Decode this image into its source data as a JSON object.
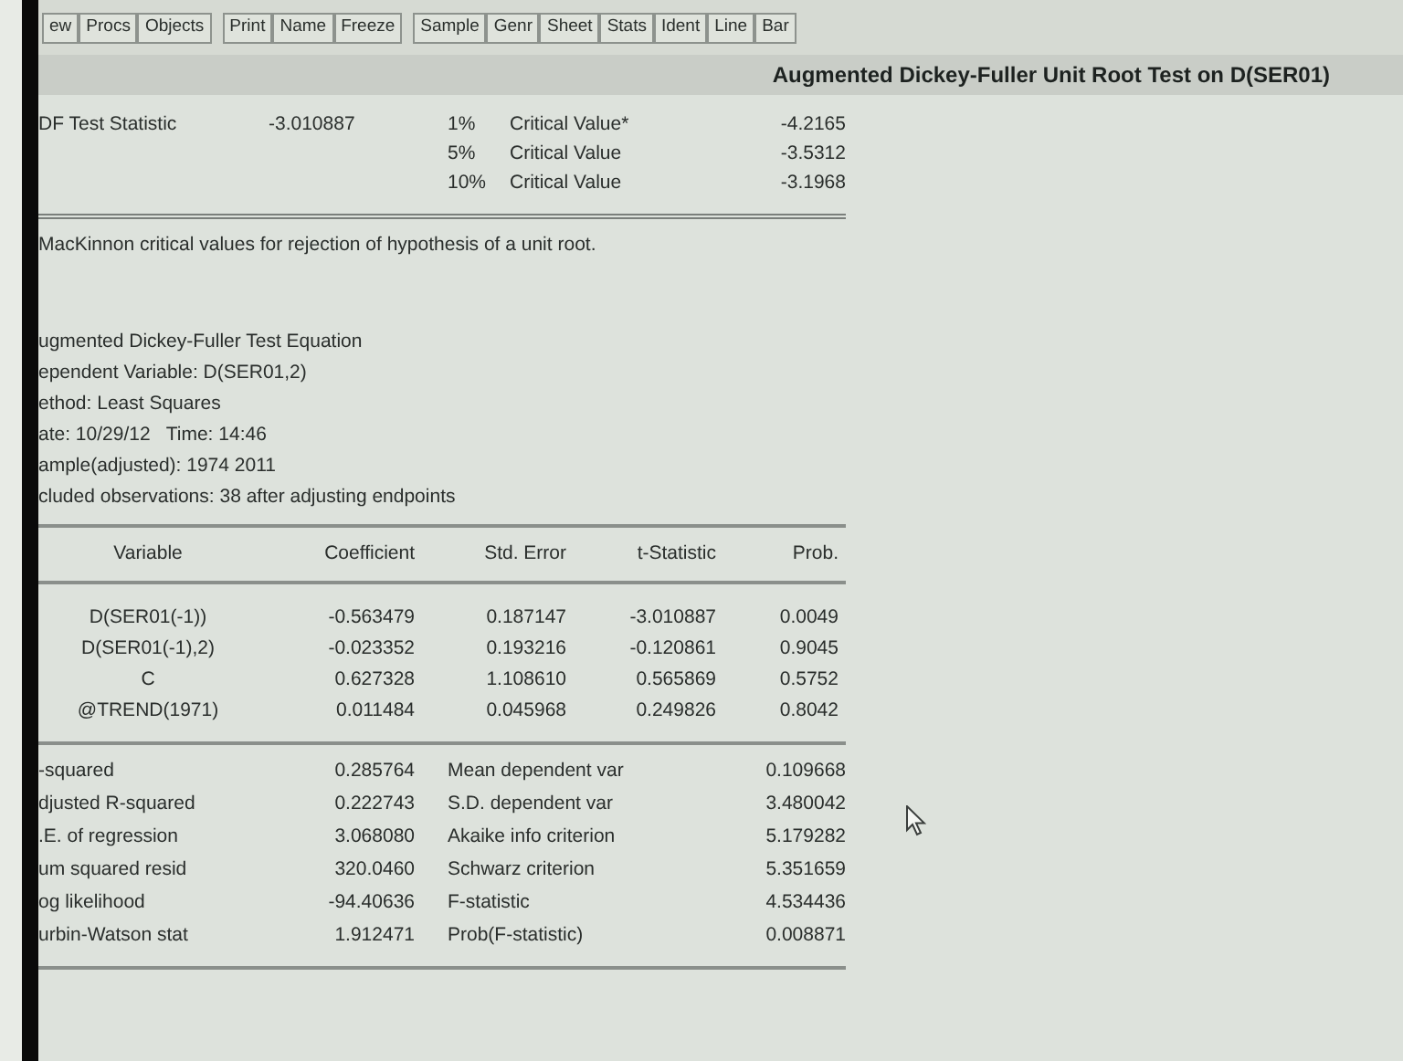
{
  "toolbar": {
    "groups": [
      [
        "ew",
        "Procs",
        "Objects"
      ],
      [
        "Print",
        "Name",
        "Freeze"
      ],
      [
        "Sample",
        "Genr",
        "Sheet",
        "Stats",
        "Ident",
        "Line",
        "Bar"
      ]
    ]
  },
  "title": "Augmented Dickey-Fuller Unit Root Test on D(SER01)",
  "adf": {
    "label": "DF Test Statistic",
    "value": "-3.010887",
    "critical_values": [
      {
        "level": "1%",
        "label": "Critical Value*",
        "value": "-4.2165"
      },
      {
        "level": "5%",
        "label": "Critical Value",
        "value": "-3.5312"
      },
      {
        "level": "10%",
        "label": "Critical Value",
        "value": "-3.1968"
      }
    ]
  },
  "note": "MacKinnon critical values for rejection of hypothesis of a unit root.",
  "equation_info": [
    "ugmented Dickey-Fuller Test Equation",
    "ependent Variable: D(SER01,2)",
    "ethod: Least Squares",
    "ate: 10/29/12   Time: 14:46",
    "ample(adjusted): 1974 2011",
    "cluded observations: 38 after adjusting endpoints"
  ],
  "coefficients": {
    "columns": [
      "Variable",
      "Coefficient",
      "Std. Error",
      "t-Statistic",
      "Prob."
    ],
    "rows": [
      [
        "D(SER01(-1))",
        "-0.563479",
        "0.187147",
        "-3.010887",
        "0.0049"
      ],
      [
        "D(SER01(-1),2)",
        "-0.023352",
        "0.193216",
        "-0.120861",
        "0.9045"
      ],
      [
        "C",
        "0.627328",
        "1.108610",
        "0.565869",
        "0.5752"
      ],
      [
        "@TREND(1971)",
        "0.011484",
        "0.045968",
        "0.249826",
        "0.8042"
      ]
    ]
  },
  "summary_stats": [
    [
      "-squared",
      "0.285764",
      "Mean dependent var",
      "0.109668"
    ],
    [
      "djusted R-squared",
      "0.222743",
      "S.D. dependent var",
      "3.480042"
    ],
    [
      ".E. of regression",
      "3.068080",
      "Akaike info criterion",
      "5.179282"
    ],
    [
      "um squared resid",
      "320.0460",
      "Schwarz criterion",
      "5.351659"
    ],
    [
      "og likelihood",
      "-94.40636",
      "F-statistic",
      "4.534436"
    ],
    [
      "urbin-Watson stat",
      "1.912471",
      "Prob(F-statistic)",
      "0.008871"
    ]
  ]
}
